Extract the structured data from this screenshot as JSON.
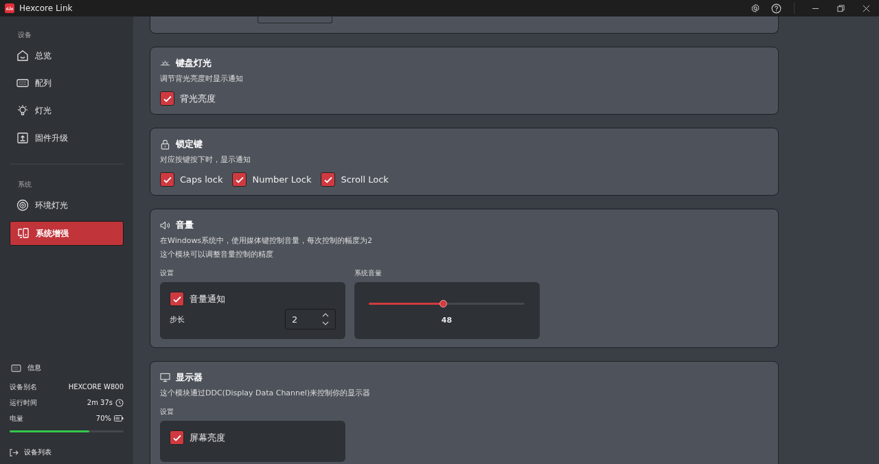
{
  "window": {
    "title": "Hexcore Link"
  },
  "sidebar": {
    "sections": [
      {
        "heading": "设备",
        "items": [
          {
            "label": "总览",
            "selected": false
          },
          {
            "label": "配列",
            "selected": false
          },
          {
            "label": "灯光",
            "selected": false
          },
          {
            "label": "固件升级",
            "selected": false
          }
        ]
      },
      {
        "heading": "系统",
        "items": [
          {
            "label": "环境灯光",
            "selected": false
          },
          {
            "label": "系统增强",
            "selected": true
          }
        ]
      }
    ],
    "info": {
      "heading": "信息",
      "rows": [
        {
          "label": "设备别名",
          "value": "HEXCORE W800"
        },
        {
          "label": "运行时间",
          "value": "2m 37s"
        },
        {
          "label": "电量",
          "value": "70%"
        }
      ],
      "battery": {
        "level": 0.7
      }
    },
    "device_list": "设备列表"
  },
  "cards": [
    {
      "kind": "checks",
      "title": "键盘灯光",
      "description": [
        "调节背光亮度时显示通知"
      ],
      "checks": [
        {
          "label": "背光亮度",
          "checked": true
        }
      ]
    },
    {
      "kind": "checks",
      "title": "锁定键",
      "description": [
        "对应按键按下时，显示通知"
      ],
      "checks": [
        {
          "label": "Caps lock",
          "checked": true
        },
        {
          "label": "Number Lock",
          "checked": true
        },
        {
          "label": "Scroll Lock",
          "checked": true
        }
      ]
    },
    {
      "kind": "volume",
      "title": "音量",
      "description": [
        "在Windows系统中，使用媒体键控制音量，每次控制的幅度为2",
        "这个模块可以调整音量控制的精度"
      ],
      "settings_label": "设置",
      "notify": {
        "label": "音量通知",
        "checked": true
      },
      "step_label": "步长",
      "step_value": "2",
      "slider_label": "系统音量",
      "slider": {
        "level": 0.48,
        "reading": "48"
      }
    },
    {
      "kind": "display",
      "title": "显示器",
      "description": [
        "这个模块通过DDC(Display Data Channel)来控制你的显示器"
      ],
      "settings_label": "设置",
      "checks": [
        {
          "label": "屏幕亮度",
          "checked": true
        }
      ]
    }
  ]
}
